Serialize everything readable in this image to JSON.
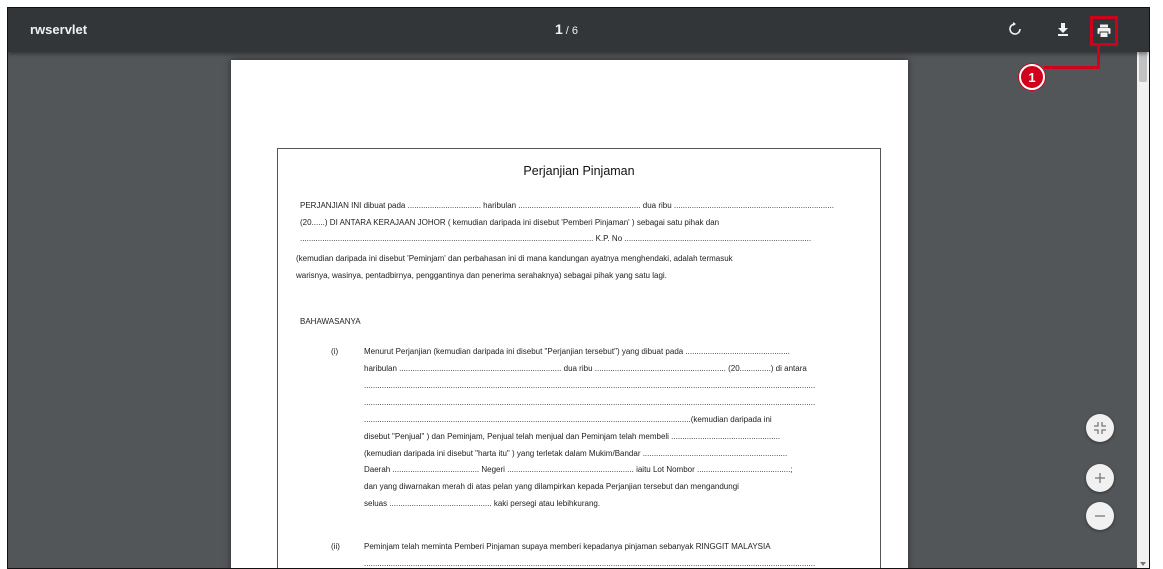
{
  "toolbar": {
    "title": "rwservlet",
    "current_page": "1",
    "separator": "/",
    "total_pages": "6",
    "icons": [
      "rotate-icon",
      "download-icon",
      "print-icon"
    ]
  },
  "annotation": {
    "callout_number": "1",
    "highlight_color": "#d0021b"
  },
  "document": {
    "title": "Perjanjian Pinjaman",
    "para1_line1": "PERJANJIAN  INI  dibuat  pada  .................................  haribulan  .......................................................  dua  ribu  ........................................................................",
    "para1_line2": "(20......)  DI  ANTARA  KERAJAAN  JOHOR  (  kemudian  daripada  ini  disebut  'Pemberi  Pinjaman'  )  sebagai  satu  pihak  dan",
    "para1_line3": "....................................................................................................................................  K.P. No ....................................................................................",
    "para2_line1": "(kemudian daripada ini disebut 'Peminjam' dan perbahasan ini di mana kandungan ayatnya menghendaki, adalah termasuk",
    "para2_line2": "warisnya, wasinya, pentadbirnya, penggantinya dan penerima serahaknya) sebagai pihak yang satu lagi.",
    "heading": "BAHAWASANYA",
    "clause1_num": "(i)",
    "clause1_lines": [
      "Menurut Perjanjian (kemudian daripada ini disebut \"Perjanjian tersebut\") yang dibuat pada ...............................................",
      "haribulan .........................................................................  dua ribu ...........................................................  (20..............) di antara",
      "...........................................................................................................................................................................................................",
      "...........................................................................................................................................................................................................",
      "...................................................................................................................................................(kemudian daripada ini",
      "disebut \"Penjual\" ) dan Peminjam, Penjual telah menjual dan Peminjam telah membeli .................................................",
      "(kemudian daripada ini disebut \"harta itu\" ) yang terletak dalam Mukim/Bandar .................................................................",
      "Daerah .......................................  Negeri .........................................................  iaitu Lot Nombor ..........................................;",
      "dan yang diwarnakan merah di atas pelan yang dilampirkan kepada Perjanjian tersebut dan mengandungi",
      "seluas ..............................................  kaki persegi atau lebihkurang."
    ],
    "clause2_num": "(ii)",
    "clause2_line1": "Peminjam telah meminta Pemberi Pinjaman supaya memberi kepadanya pinjaman sebanyak RINGGIT MALAYSIA",
    "clause2_line2": "..........................................................................................................................................................................................................."
  }
}
